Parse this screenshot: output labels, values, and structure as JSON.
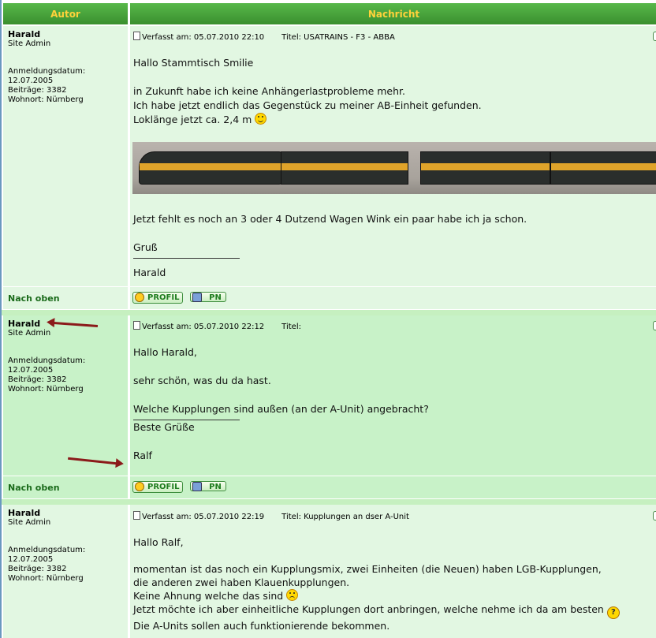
{
  "header": {
    "author_col": "Autor",
    "message_col": "Nachricht"
  },
  "posts": [
    {
      "author": {
        "name": "Harald",
        "rank": "Site Admin",
        "info": "Anmeldungsdatum:\n12.07.2005\nBeiträge: 3382\nWohnort: Nürnberg"
      },
      "date": "Verfasst am: 05.07.2010 22:10",
      "title": "Titel: USATRAINS - F3 - ABBA",
      "lines": {
        "l1": "Hallo Stammtisch Smilie",
        "l2": "in Zukunft habe ich keine Anhängerlastprobleme mehr.",
        "l3": "Ich habe jetzt endlich das Gegenstück zu meiner AB-Einheit gefunden.",
        "l4": "Loklänge jetzt ca. 2,4 m",
        "l5": "Jetzt fehlt es noch an 3 oder 4 Dutzend Wagen Wink ein paar habe ich ja schon.",
        "l6": "Gruß",
        "l7": "Harald"
      }
    },
    {
      "author": {
        "name": "Harald",
        "rank": "Site Admin",
        "info": "Anmeldungsdatum:\n12.07.2005\nBeiträge: 3382\nWohnort: Nürnberg"
      },
      "date": "Verfasst am: 05.07.2010 22:12",
      "title": "Titel:",
      "lines": {
        "l1": "Hallo Harald,",
        "l2": "sehr schön, was du da hast.",
        "l3": "Welche Kupplungen sind außen (an der A-Unit) angebracht?",
        "l4": "Beste Grüße",
        "l5": "Ralf"
      }
    },
    {
      "author": {
        "name": "Harald",
        "rank": "Site Admin",
        "info": "Anmeldungsdatum:\n12.07.2005\nBeiträge: 3382\nWohnort: Nürnberg"
      },
      "date": "Verfasst am: 05.07.2010 22:19",
      "title": "Titel: Kupplungen an dser A-Unit",
      "lines": {
        "l1": "Hallo Ralf,",
        "l2": "momentan ist das noch ein Kupplungsmix, zwei Einheiten (die Neuen) haben LGB-Kupplungen,",
        "l3": "die anderen zwei haben Klauenkupplungen.",
        "l4": "Keine Ahnung welche das sind",
        "l5": "Jetzt möchte ich aber einheitliche Kupplungen dort anbringen, welche nehme ich da am besten",
        "l6": "Die A-Units sollen auch funktionierende bekommen."
      }
    }
  ],
  "nav": {
    "top_link": "Nach oben",
    "profile_btn": "PROFIL",
    "pm_btn": "PN"
  },
  "icons": {
    "post": "post-icon",
    "smile": "smile-icon",
    "sad": "sad-icon",
    "question": "question-icon",
    "arrow": "red-arrow"
  },
  "colors": {
    "header_green": "#3a8f2e",
    "header_text": "#ffd23a",
    "row_light": "#e2f7e2",
    "row_alt": "#c8f2c8",
    "arrow": "#8b1a1a"
  }
}
